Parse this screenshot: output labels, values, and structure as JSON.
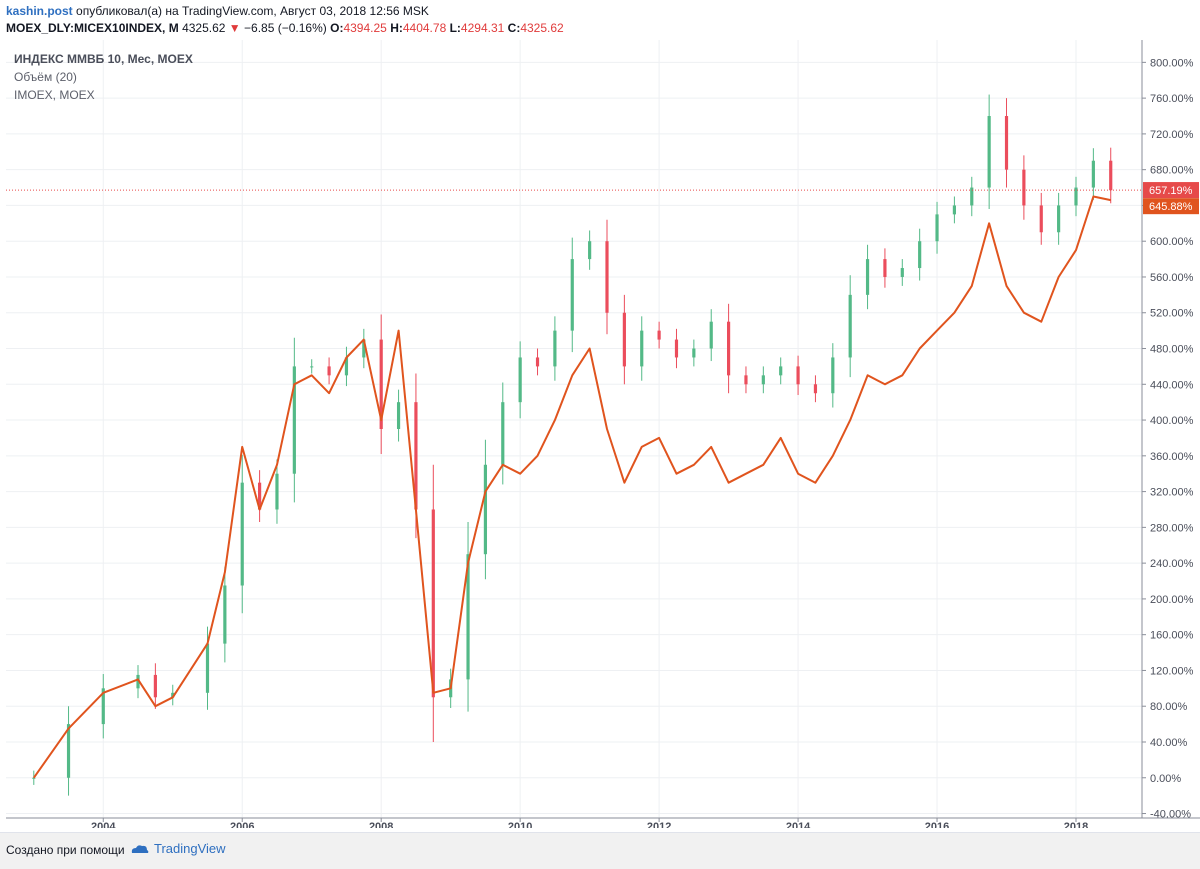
{
  "header": {
    "author": "kashin.post",
    "published_text": "опубликовал(а) на TradingView.com, Август 03, 2018 12:56 MSK",
    "symbol": "MOEX_DLY:MICEX10INDEX, M",
    "price": "4325.62",
    "change_arrow": "▼",
    "change": "−6.85 (−0.16%)",
    "open_label": "O:",
    "open": "4394.25",
    "high_label": "H:",
    "high": "4404.78",
    "low_label": "L:",
    "low": "4294.31",
    "close_label": "C:",
    "close": "4325.62"
  },
  "legend": {
    "line1": "ИНДЕКС ММВБ 10, Мес, MOEX",
    "line2": "Объём (20)",
    "line3": "IMOEX, MOEX"
  },
  "footer": {
    "created_with": "Создано при помощи",
    "brand": "TradingView"
  },
  "colors": {
    "up": "#53b987",
    "down": "#eb4d5c",
    "compare_line": "#e0541e",
    "price_line": "#e64a4a",
    "grid": "#eef0f3"
  },
  "chart_data": {
    "type": "line",
    "title": "ИНДЕКС ММВБ 10, Мес, MOEX",
    "y_unit": "%",
    "ylim": [
      -45,
      825
    ],
    "y_ticks": [
      -40,
      0,
      40,
      80,
      120,
      160,
      200,
      240,
      280,
      320,
      360,
      400,
      440,
      480,
      520,
      560,
      600,
      640,
      680,
      720,
      760,
      800
    ],
    "y_tick_labels": [
      "-40.00%",
      "0.00%",
      "40.00%",
      "80.00%",
      "120.00%",
      "160.00%",
      "200.00%",
      "240.00%",
      "280.00%",
      "320.00%",
      "360.00%",
      "400.00%",
      "440.00%",
      "480.00%",
      "520.00%",
      "560.00%",
      "600.00%",
      "640.00%",
      "680.00%",
      "720.00%",
      "760.00%",
      "800.00%"
    ],
    "xlim": [
      2002.6,
      2018.95
    ],
    "x_ticks": [
      2004,
      2006,
      2008,
      2010,
      2012,
      2014,
      2016,
      2018
    ],
    "x_tick_labels": [
      "2004",
      "2006",
      "2008",
      "2010",
      "2012",
      "2014",
      "2016",
      "2018"
    ],
    "grid": true,
    "last_value_labels": [
      {
        "series": "ИНДЕКС ММВБ 10",
        "label": "657.19%",
        "value": 657.19
      },
      {
        "series": "IMOEX",
        "label": "645.88%",
        "value": 645.88
      }
    ],
    "series": [
      {
        "name": "ИНДЕКС ММВБ 10",
        "kind": "candlestick",
        "x": [
          2003.0,
          2003.5,
          2004.0,
          2004.5,
          2004.75,
          2005.0,
          2005.5,
          2005.75,
          2006.0,
          2006.25,
          2006.5,
          2006.75,
          2007.0,
          2007.25,
          2007.5,
          2007.75,
          2008.0,
          2008.25,
          2008.5,
          2008.75,
          2009.0,
          2009.25,
          2009.5,
          2009.75,
          2010.0,
          2010.25,
          2010.5,
          2010.75,
          2011.0,
          2011.25,
          2011.5,
          2011.75,
          2012.0,
          2012.25,
          2012.5,
          2012.75,
          2013.0,
          2013.25,
          2013.5,
          2013.75,
          2014.0,
          2014.25,
          2014.5,
          2014.75,
          2015.0,
          2015.25,
          2015.5,
          2015.75,
          2016.0,
          2016.25,
          2016.5,
          2016.75,
          2017.0,
          2017.25,
          2017.5,
          2017.75,
          2018.0,
          2018.25,
          2018.5
        ],
        "y": [
          0,
          60,
          100,
          115,
          90,
          95,
          150,
          215,
          330,
          300,
          340,
          460,
          460,
          450,
          470,
          490,
          390,
          420,
          300,
          90,
          110,
          250,
          350,
          420,
          470,
          460,
          500,
          580,
          600,
          520,
          460,
          500,
          490,
          470,
          480,
          510,
          450,
          440,
          450,
          460,
          440,
          430,
          470,
          540,
          580,
          560,
          570,
          600,
          630,
          640,
          660,
          740,
          680,
          640,
          610,
          640,
          660,
          690,
          657
        ]
      },
      {
        "name": "IMOEX",
        "kind": "line",
        "x": [
          2003.0,
          2003.5,
          2004.0,
          2004.5,
          2004.75,
          2005.0,
          2005.5,
          2005.75,
          2006.0,
          2006.25,
          2006.5,
          2006.75,
          2007.0,
          2007.25,
          2007.5,
          2007.75,
          2008.0,
          2008.25,
          2008.5,
          2008.75,
          2009.0,
          2009.25,
          2009.5,
          2009.75,
          2010.0,
          2010.25,
          2010.5,
          2010.75,
          2011.0,
          2011.25,
          2011.5,
          2011.75,
          2012.0,
          2012.25,
          2012.5,
          2012.75,
          2013.0,
          2013.25,
          2013.5,
          2013.75,
          2014.0,
          2014.25,
          2014.5,
          2014.75,
          2015.0,
          2015.25,
          2015.5,
          2015.75,
          2016.0,
          2016.25,
          2016.5,
          2016.75,
          2017.0,
          2017.25,
          2017.5,
          2017.75,
          2018.0,
          2018.25,
          2018.5
        ],
        "y": [
          0,
          55,
          95,
          110,
          80,
          90,
          150,
          230,
          370,
          300,
          350,
          440,
          450,
          430,
          470,
          490,
          400,
          500,
          300,
          95,
          100,
          240,
          320,
          350,
          340,
          360,
          400,
          450,
          480,
          390,
          330,
          370,
          380,
          340,
          350,
          370,
          330,
          340,
          350,
          380,
          340,
          330,
          360,
          400,
          450,
          440,
          450,
          480,
          500,
          520,
          550,
          620,
          550,
          520,
          510,
          560,
          590,
          650,
          646
        ]
      }
    ]
  }
}
